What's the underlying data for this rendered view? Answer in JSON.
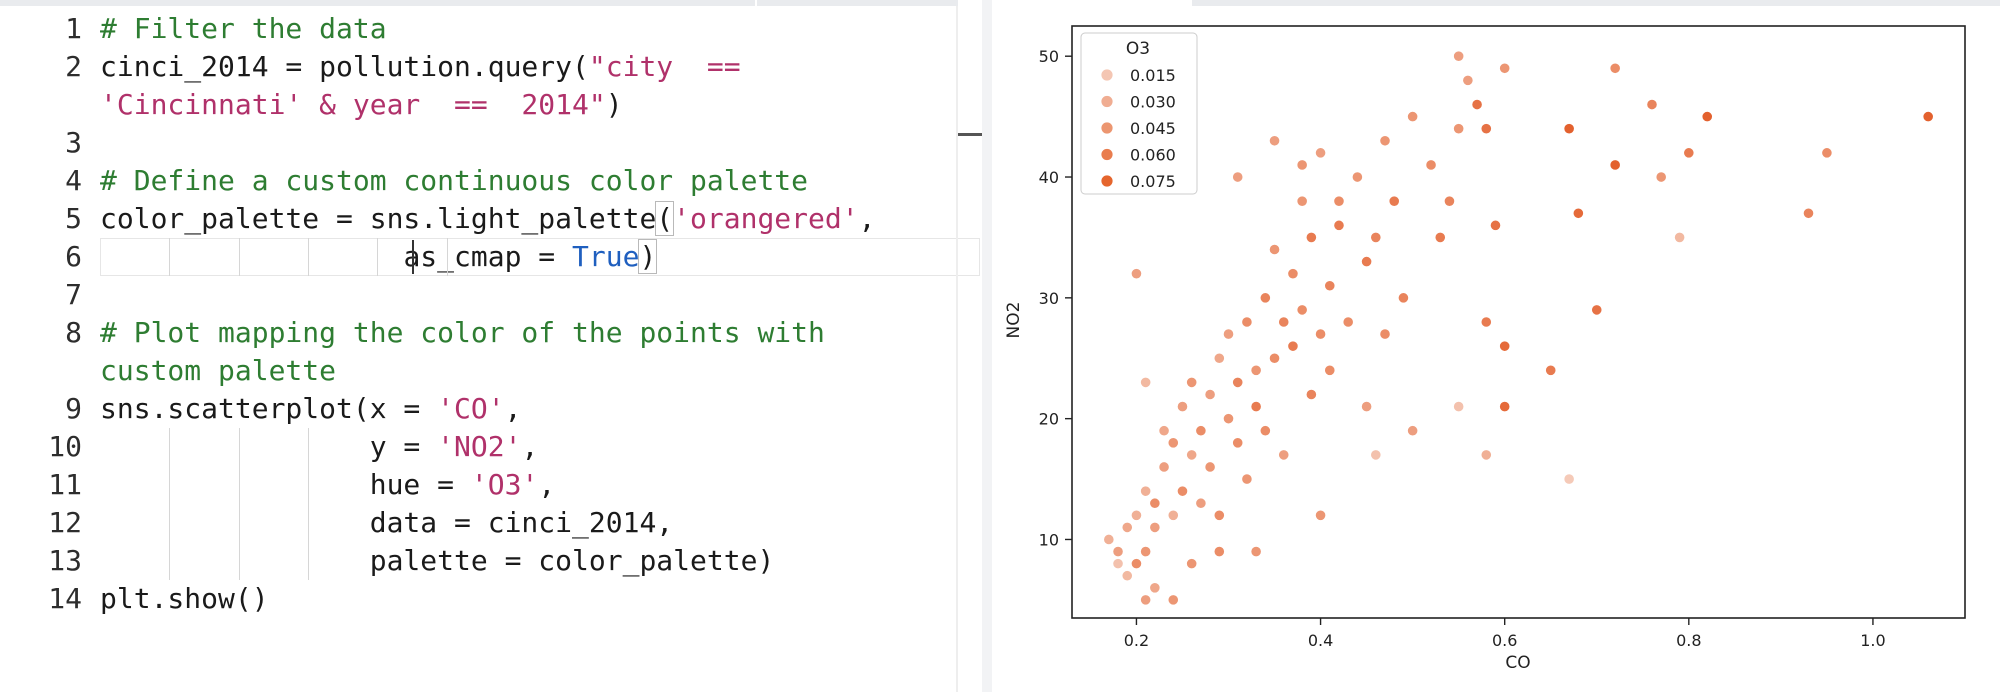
{
  "editor": {
    "lines": [
      {
        "n": "1",
        "tokens": [
          {
            "t": "# Filter the data",
            "c": "cmt"
          }
        ]
      },
      {
        "n": "2",
        "tokens": [
          {
            "t": "cinci_2014 = pollution.query(",
            "c": ""
          },
          {
            "t": "\"city  ==",
            "c": "str"
          }
        ]
      },
      {
        "n": "",
        "tokens": [
          {
            "t": "'Cincinnati' & year  ==  2014\"",
            "c": "str"
          },
          {
            "t": ")",
            "c": ""
          }
        ]
      },
      {
        "n": "3",
        "tokens": []
      },
      {
        "n": "4",
        "tokens": [
          {
            "t": "# Define a custom continuous color palette",
            "c": "cmt"
          }
        ]
      },
      {
        "n": "5",
        "tokens": [
          {
            "t": "color_palette = sns.light_palette",
            "c": ""
          },
          {
            "t": "(",
            "c": "box"
          },
          {
            "t": "'orangered'",
            "c": "str"
          },
          {
            "t": ",",
            "c": ""
          }
        ]
      },
      {
        "n": "6",
        "tokens": [
          {
            "t": "                  ",
            "c": ""
          },
          {
            "t": "as_cmap = ",
            "c": ""
          },
          {
            "t": "True",
            "c": "kw"
          },
          {
            "t": ")",
            "c": "box"
          }
        ]
      },
      {
        "n": "7",
        "tokens": []
      },
      {
        "n": "8",
        "tokens": [
          {
            "t": "# Plot mapping the color of the points with",
            "c": "cmt"
          }
        ]
      },
      {
        "n": "",
        "tokens": [
          {
            "t": "custom palette",
            "c": "cmt"
          }
        ]
      },
      {
        "n": "9",
        "tokens": [
          {
            "t": "sns.scatterplot(x = ",
            "c": ""
          },
          {
            "t": "'CO'",
            "c": "str"
          },
          {
            "t": ",",
            "c": ""
          }
        ]
      },
      {
        "n": "10",
        "tokens": [
          {
            "t": "                ",
            "c": ""
          },
          {
            "t": "y = ",
            "c": ""
          },
          {
            "t": "'NO2'",
            "c": "str"
          },
          {
            "t": ",",
            "c": ""
          }
        ]
      },
      {
        "n": "11",
        "tokens": [
          {
            "t": "                ",
            "c": ""
          },
          {
            "t": "hue = ",
            "c": ""
          },
          {
            "t": "'O3'",
            "c": "str"
          },
          {
            "t": ",",
            "c": ""
          }
        ]
      },
      {
        "n": "12",
        "tokens": [
          {
            "t": "                data = cinci_2014,",
            "c": ""
          }
        ]
      },
      {
        "n": "13",
        "tokens": [
          {
            "t": "                palette = color_palette)",
            "c": ""
          }
        ]
      },
      {
        "n": "14",
        "tokens": [
          {
            "t": "plt.show()",
            "c": ""
          }
        ]
      }
    ]
  },
  "chart_data": {
    "type": "scatter",
    "xlabel": "CO",
    "ylabel": "NO2",
    "xlim": [
      0.13,
      1.1
    ],
    "ylim": [
      3.5,
      52.5
    ],
    "xticks": [
      "0.2",
      "0.4",
      "0.6",
      "0.8",
      "1.0"
    ],
    "yticks": [
      "10",
      "20",
      "30",
      "40",
      "50"
    ],
    "legend": {
      "title": "O3",
      "placement": "top-left",
      "entries": [
        {
          "label": "0.015",
          "color": "#f4c6b3"
        },
        {
          "label": "0.030",
          "color": "#f0ad92"
        },
        {
          "label": "0.045",
          "color": "#ec9670"
        },
        {
          "label": "0.060",
          "color": "#e97d4e"
        },
        {
          "label": "0.075",
          "color": "#e5652d"
        }
      ]
    },
    "points": [
      [
        0.17,
        10,
        0.03
      ],
      [
        0.18,
        8,
        0.02
      ],
      [
        0.18,
        9,
        0.04
      ],
      [
        0.19,
        7,
        0.025
      ],
      [
        0.19,
        11,
        0.035
      ],
      [
        0.2,
        12,
        0.03
      ],
      [
        0.2,
        8,
        0.05
      ],
      [
        0.21,
        5,
        0.04
      ],
      [
        0.21,
        9,
        0.045
      ],
      [
        0.21,
        14,
        0.03
      ],
      [
        0.22,
        6,
        0.035
      ],
      [
        0.22,
        11,
        0.04
      ],
      [
        0.22,
        13,
        0.05
      ],
      [
        0.23,
        16,
        0.04
      ],
      [
        0.23,
        19,
        0.035
      ],
      [
        0.24,
        5,
        0.045
      ],
      [
        0.24,
        12,
        0.03
      ],
      [
        0.24,
        18,
        0.045
      ],
      [
        0.25,
        21,
        0.04
      ],
      [
        0.25,
        14,
        0.05
      ],
      [
        0.26,
        17,
        0.035
      ],
      [
        0.26,
        23,
        0.045
      ],
      [
        0.27,
        13,
        0.04
      ],
      [
        0.27,
        19,
        0.05
      ],
      [
        0.28,
        16,
        0.045
      ],
      [
        0.28,
        22,
        0.04
      ],
      [
        0.29,
        25,
        0.035
      ],
      [
        0.29,
        12,
        0.05
      ],
      [
        0.3,
        20,
        0.045
      ],
      [
        0.3,
        27,
        0.04
      ],
      [
        0.31,
        18,
        0.05
      ],
      [
        0.31,
        23,
        0.055
      ],
      [
        0.32,
        15,
        0.045
      ],
      [
        0.32,
        28,
        0.05
      ],
      [
        0.33,
        21,
        0.06
      ],
      [
        0.33,
        24,
        0.045
      ],
      [
        0.34,
        19,
        0.05
      ],
      [
        0.34,
        30,
        0.055
      ],
      [
        0.35,
        25,
        0.05
      ],
      [
        0.35,
        34,
        0.045
      ],
      [
        0.36,
        28,
        0.055
      ],
      [
        0.36,
        17,
        0.04
      ],
      [
        0.37,
        32,
        0.05
      ],
      [
        0.37,
        26,
        0.06
      ],
      [
        0.38,
        38,
        0.045
      ],
      [
        0.38,
        29,
        0.05
      ],
      [
        0.39,
        22,
        0.055
      ],
      [
        0.39,
        35,
        0.06
      ],
      [
        0.4,
        27,
        0.05
      ],
      [
        0.4,
        42,
        0.04
      ],
      [
        0.41,
        31,
        0.055
      ],
      [
        0.41,
        24,
        0.05
      ],
      [
        0.42,
        36,
        0.06
      ],
      [
        0.43,
        28,
        0.05
      ],
      [
        0.44,
        40,
        0.045
      ],
      [
        0.45,
        33,
        0.06
      ],
      [
        0.45,
        21,
        0.04
      ],
      [
        0.46,
        35,
        0.055
      ],
      [
        0.47,
        27,
        0.05
      ],
      [
        0.48,
        38,
        0.06
      ],
      [
        0.49,
        30,
        0.055
      ],
      [
        0.5,
        45,
        0.045
      ],
      [
        0.5,
        19,
        0.04
      ],
      [
        0.52,
        41,
        0.05
      ],
      [
        0.53,
        35,
        0.06
      ],
      [
        0.54,
        38,
        0.055
      ],
      [
        0.55,
        50,
        0.04
      ],
      [
        0.55,
        44,
        0.045
      ],
      [
        0.56,
        48,
        0.04
      ],
      [
        0.57,
        46,
        0.065
      ],
      [
        0.58,
        44,
        0.065
      ],
      [
        0.58,
        28,
        0.06
      ],
      [
        0.59,
        36,
        0.065
      ],
      [
        0.6,
        49,
        0.045
      ],
      [
        0.6,
        21,
        0.07
      ],
      [
        0.6,
        26,
        0.07
      ],
      [
        0.65,
        24,
        0.06
      ],
      [
        0.67,
        44,
        0.075
      ],
      [
        0.68,
        37,
        0.07
      ],
      [
        0.7,
        29,
        0.065
      ],
      [
        0.72,
        49,
        0.05
      ],
      [
        0.72,
        41,
        0.075
      ],
      [
        0.76,
        46,
        0.055
      ],
      [
        0.77,
        40,
        0.045
      ],
      [
        0.79,
        35,
        0.025
      ],
      [
        0.8,
        42,
        0.06
      ],
      [
        0.82,
        45,
        0.075
      ],
      [
        0.93,
        37,
        0.055
      ],
      [
        0.95,
        42,
        0.05
      ],
      [
        1.06,
        45,
        0.075
      ],
      [
        0.58,
        17,
        0.03
      ],
      [
        0.55,
        21,
        0.02
      ],
      [
        0.67,
        15,
        0.015
      ],
      [
        0.46,
        17,
        0.02
      ],
      [
        0.2,
        32,
        0.04
      ],
      [
        0.21,
        23,
        0.025
      ],
      [
        0.35,
        43,
        0.04
      ],
      [
        0.47,
        43,
        0.045
      ],
      [
        0.4,
        12,
        0.045
      ],
      [
        0.33,
        9,
        0.045
      ],
      [
        0.29,
        9,
        0.05
      ],
      [
        0.26,
        8,
        0.045
      ],
      [
        0.31,
        40,
        0.04
      ],
      [
        0.38,
        41,
        0.045
      ],
      [
        0.42,
        38,
        0.05
      ]
    ]
  }
}
